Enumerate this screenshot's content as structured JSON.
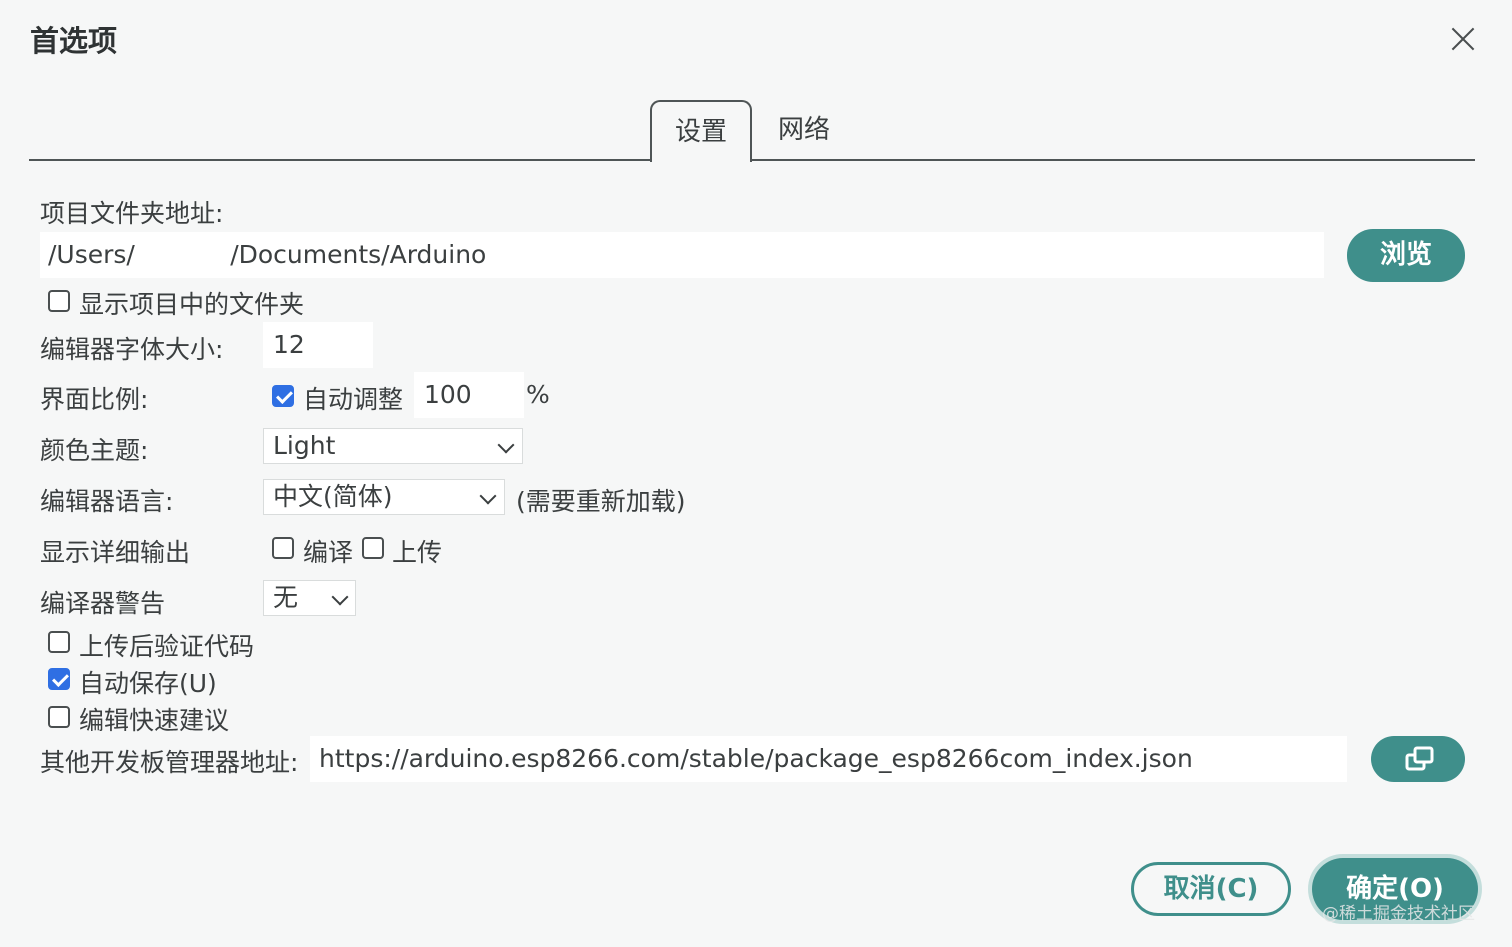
{
  "dialog": {
    "title": "首选项",
    "close_icon": "close-icon"
  },
  "tabs": [
    {
      "label": "设置",
      "active": true
    },
    {
      "label": "网络",
      "active": false
    }
  ],
  "settings": {
    "sketchbook_label": "项目文件夹地址:",
    "sketchbook_path": "/Users/            /Documents/Arduino",
    "browse_label": "浏览",
    "show_files_label": "显示项目中的文件夹",
    "show_files_checked": false,
    "font_size_label": "编辑器字体大小:",
    "font_size_value": "12",
    "scale_label": "界面比例:",
    "auto_scale_label": "自动调整",
    "auto_scale_checked": true,
    "scale_value": "100",
    "scale_unit": "%",
    "theme_label": "颜色主题:",
    "theme_value": "Light",
    "language_label": "编辑器语言:",
    "language_value": "中文(简体)",
    "language_note": "(需要重新加载)",
    "verbose_label": "显示详细输出",
    "verbose_compile_label": "编译",
    "verbose_compile_checked": false,
    "verbose_upload_label": "上传",
    "verbose_upload_checked": false,
    "warnings_label": "编译器警告",
    "warnings_value": "无",
    "verify_label": "上传后验证代码",
    "verify_checked": false,
    "autosave_label": "自动保存(U)",
    "autosave_checked": true,
    "quick_suggest_label": "编辑快速建议",
    "quick_suggest_checked": false,
    "board_urls_label": "其他开发板管理器地址:",
    "board_urls_value": "https://arduino.esp8266.com/stable/package_esp8266com_index.json",
    "board_urls_icon": "open-window-icon"
  },
  "footer": {
    "cancel_label": "取消(C)",
    "ok_label": "确定(O)",
    "watermark": "@稀土掘金技术社区"
  },
  "colors": {
    "accent": "#3f8f8b",
    "checkbox_checked": "#2f6fe3",
    "background": "#f6f7f7"
  }
}
